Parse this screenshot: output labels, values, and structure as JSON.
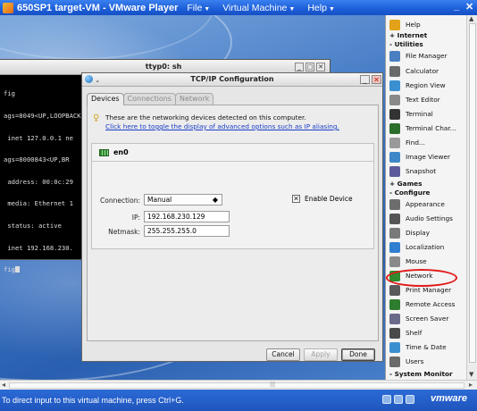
{
  "window": {
    "title": "650SP1 target-VM - VMware Player",
    "menu": [
      {
        "label": "File",
        "mnemonic": "F"
      },
      {
        "label": "Virtual Machine",
        "mnemonic": "V"
      },
      {
        "label": "Help",
        "mnemonic": "H"
      }
    ],
    "minimize": "_",
    "close": "✕"
  },
  "terminal": {
    "title": "ttyp0: sh",
    "lines": [
      "fig",
      "ags=8049<UP,LOOPBACK,RUNNING,MULTICAST> mtu 33192",
      " inet 127.0.0.1 ne",
      "ags=8000843<UP,BR",
      " address: 00:0c:29",
      " media: Ethernet 1",
      " status: active",
      " inet 192.168.230.",
      "fig"
    ]
  },
  "dialog": {
    "title": "TCP/IP Configuration",
    "tabs": [
      "Devices",
      "Connections",
      "Network"
    ],
    "info_text": "These are the networking devices detected on this computer.",
    "info_link": "Click here to toggle the display of advanced options such as IP aliasing.",
    "device": {
      "name": "en0",
      "connection_label": "Connection:",
      "connection_value": "Manual",
      "enable_label": "Enable Device",
      "enable_checked": true,
      "ip_label": "IP:",
      "ip_value": "192.168.230.129",
      "netmask_label": "Netmask:",
      "netmask_value": "255.255.255.0"
    },
    "buttons": {
      "cancel": "Cancel",
      "apply": "Apply",
      "done": "Done"
    }
  },
  "launcher": {
    "items": [
      {
        "kind": "item",
        "label": "Help",
        "icon": "help-icon",
        "color": "#e3a21a"
      },
      {
        "kind": "header",
        "label": "+ Internet"
      },
      {
        "kind": "header",
        "label": "- Utilities"
      },
      {
        "kind": "item",
        "label": "File Manager",
        "icon": "file-manager-icon",
        "color": "#4a7fc1"
      },
      {
        "kind": "item",
        "label": "Calculator",
        "icon": "calculator-icon",
        "color": "#6a6a6a"
      },
      {
        "kind": "item",
        "label": "Region View",
        "icon": "region-view-icon",
        "color": "#3a8fd0"
      },
      {
        "kind": "item",
        "label": "Text Editor",
        "icon": "text-editor-icon",
        "color": "#8a8a8a"
      },
      {
        "kind": "item",
        "label": "Terminal",
        "icon": "terminal-icon",
        "color": "#333333"
      },
      {
        "kind": "item",
        "label": "Terminal Char...",
        "icon": "terminal-char-icon",
        "color": "#2c6e2c"
      },
      {
        "kind": "item",
        "label": "Find...",
        "icon": "find-icon",
        "color": "#9a9a9a"
      },
      {
        "kind": "item",
        "label": "Image Viewer",
        "icon": "image-viewer-icon",
        "color": "#3f86c9"
      },
      {
        "kind": "item",
        "label": "Snapshot",
        "icon": "snapshot-icon",
        "color": "#5b5b9b"
      },
      {
        "kind": "header",
        "label": "+ Games"
      },
      {
        "kind": "header",
        "label": "- Configure"
      },
      {
        "kind": "item",
        "label": "Appearance",
        "icon": "appearance-icon",
        "color": "#6d6d6d"
      },
      {
        "kind": "item",
        "label": "Audio Settings",
        "icon": "audio-settings-icon",
        "color": "#555555"
      },
      {
        "kind": "item",
        "label": "Display",
        "icon": "display-icon",
        "color": "#7a7a7a"
      },
      {
        "kind": "item",
        "label": "Localization",
        "icon": "localization-icon",
        "color": "#2f7fd1"
      },
      {
        "kind": "item",
        "label": "Mouse",
        "icon": "mouse-icon",
        "color": "#8a8a8a"
      },
      {
        "kind": "item",
        "label": "Network",
        "icon": "network-icon",
        "color": "#2e8b2e"
      },
      {
        "kind": "item",
        "label": "Print Manager",
        "icon": "print-manager-icon",
        "color": "#5a5a5a"
      },
      {
        "kind": "item",
        "label": "Remote Access",
        "icon": "remote-access-icon",
        "color": "#2e7d2e"
      },
      {
        "kind": "item",
        "label": "Screen Saver",
        "icon": "screen-saver-icon",
        "color": "#6a6a8a"
      },
      {
        "kind": "item",
        "label": "Shelf",
        "icon": "shelf-icon",
        "color": "#4a4a4a"
      },
      {
        "kind": "item",
        "label": "Time & Date",
        "icon": "time-date-icon",
        "color": "#3a8fd0"
      },
      {
        "kind": "item",
        "label": "Users",
        "icon": "users-icon",
        "color": "#6a6a6a"
      },
      {
        "kind": "header",
        "label": "- System Monitor"
      }
    ]
  },
  "status_bar": {
    "message": "To direct input to this virtual machine, press Ctrl+G.",
    "brand": "vmware"
  }
}
